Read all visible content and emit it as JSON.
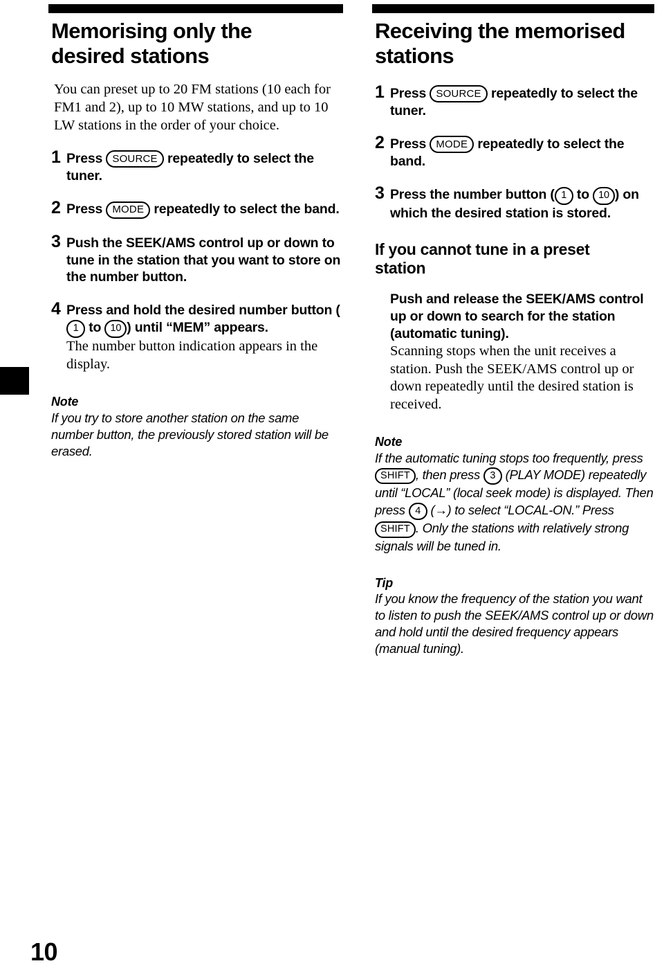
{
  "page": {
    "number": "10",
    "tab_marker": "black-index-tab"
  },
  "left_column": {
    "title": "Memorising only the desired stations",
    "intro": "You can preset up to 20 FM stations (10 each for FM1 and 2), up to 10 MW stations, and up to 10 LW stations in the order of your choice.",
    "steps": [
      {
        "number": "1",
        "text_before": "Press",
        "key": "SOURCE",
        "text_after": "repeatedly to select the tuner."
      },
      {
        "number": "2",
        "text_before": "Press",
        "key": "MODE",
        "text_after": "repeatedly to select the band."
      },
      {
        "number": "3",
        "text": "Push the SEEK/AMS control up or down to tune in the station that you want to store on the number button."
      },
      {
        "number": "4",
        "text_before": "Press and hold the desired number button (",
        "key_first": "1",
        "text_middle": "to",
        "key_last": "10",
        "text_after": ") until “MEM” appears.",
        "sub_text": "The number button indication appears in the display."
      }
    ],
    "note": {
      "label": "Note",
      "body": "If you try to store another station on the same number button, the previously stored station will be erased."
    }
  },
  "right_column": {
    "title": "Receiving the memorised stations",
    "steps": [
      {
        "number": "1",
        "text_before": "Press",
        "key": "SOURCE",
        "text_after": "repeatedly to select the tuner."
      },
      {
        "number": "2",
        "text_before": "Press",
        "key": "MODE",
        "text_after": "repeatedly to select the band."
      },
      {
        "number": "3",
        "text_before": "Press the number button (",
        "key_first": "1",
        "text_middle": "to",
        "key_last": "10",
        "text_after": ") on which the desired station is stored."
      }
    ],
    "subsection": {
      "title": "If you cannot tune in a preset station",
      "bold_lead": "Push and release the SEEK/AMS control up or down to search for the station (automatic tuning).",
      "serif_follow": "Scanning stops when the unit receives a station. Push the SEEK/AMS control up or down repeatedly until the desired station is received."
    },
    "note": {
      "label": "Note",
      "part1": "If the automatic tuning stops too frequently, press",
      "key1": "SHIFT",
      "part2": ", then press",
      "key2": "3",
      "part3": "(PLAY MODE) repeatedly until “LOCAL” (local seek mode) is displayed. Then press",
      "key3": "4",
      "part4": "(",
      "arrow": "→",
      "part5": ") to select “LOCAL-ON.” Press",
      "key4": "SHIFT",
      "part6": ".",
      "part7": "Only the stations with relatively strong signals will be tuned in."
    },
    "tip": {
      "label": "Tip",
      "body": "If you know the frequency of the station you want to listen to push the SEEK/AMS control up or down and hold until the desired frequency appears (manual tuning)."
    }
  }
}
